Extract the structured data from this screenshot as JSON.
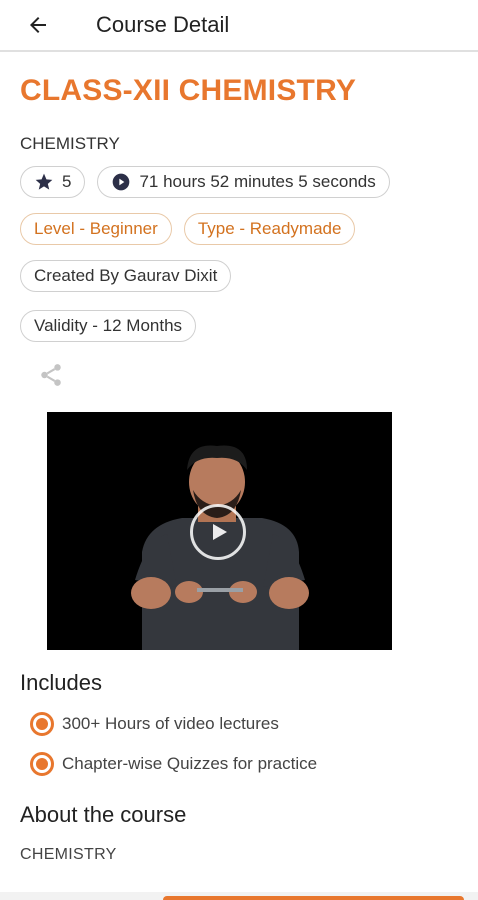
{
  "appbar": {
    "title": "Course Detail"
  },
  "course": {
    "title": "CLASS-XII CHEMISTRY",
    "subject": "CHEMISTRY",
    "rating": "5",
    "duration": "71 hours 52 minutes 5 seconds",
    "level": "Level - Beginner",
    "type": "Type - Readymade",
    "created_by": "Created By Gaurav Dixit",
    "validity": "Validity - 12 Months"
  },
  "includes": {
    "title": "Includes",
    "items": [
      "300+ Hours of video lectures",
      "Chapter-wise Quizzes for practice"
    ]
  },
  "about": {
    "title": "About the course",
    "text": "CHEMISTRY"
  },
  "colors": {
    "accent": "#e8772e",
    "chip_border": "#d0d0d0"
  }
}
